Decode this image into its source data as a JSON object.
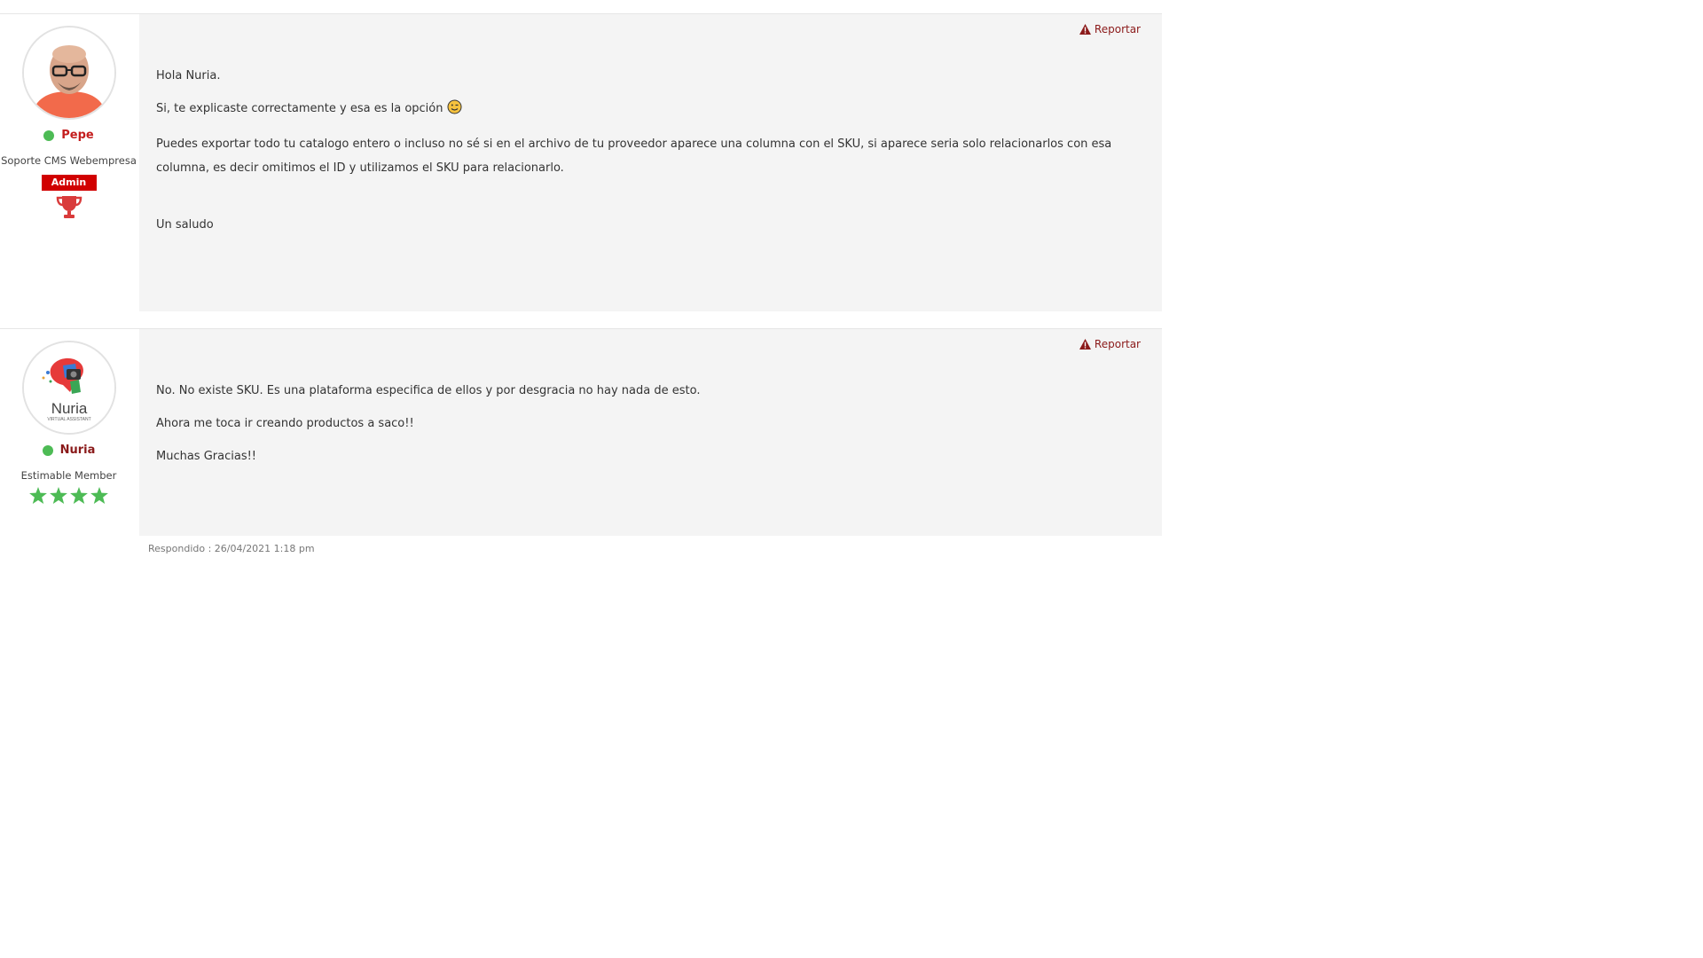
{
  "posts": [
    {
      "author": {
        "name": "Pepe",
        "online": true,
        "title": "Soporte CMS Webempresa",
        "badge": "Admin",
        "award_icon": "trophy-icon"
      },
      "report_label": "Reportar",
      "paragraphs": [
        "Hola Nuria.",
        "Si, te explicaste correctamente y esa es la opción",
        "Puedes exportar todo tu catalogo entero o incluso no sé si en el archivo de tu proveedor aparece una columna con el SKU, si aparece seria solo relacionarlos con esa columna, es decir omitimos el ID y utilizamos el SKU para relacionarlo.",
        "Un saludo"
      ],
      "emoji": "winking-face-icon"
    },
    {
      "author": {
        "name": "Nuria",
        "online": true,
        "title": "Estimable Member",
        "stars": 4,
        "avatar_text": "Nuria",
        "avatar_subtext": "VIRTUAL ASSISTANT"
      },
      "report_label": "Reportar",
      "paragraphs": [
        "No. No existe SKU. Es una plataforma especifica de ellos y por desgracia no hay nada de esto.",
        "Ahora me toca ir creando productos a saco!!",
        "Muchas Gracias!!"
      ],
      "timestamp": "Respondido : 26/04/2021 1:18 pm"
    }
  ],
  "colors": {
    "online": "#4dbb55",
    "admin_badge": "#d10000",
    "report": "#8b1a1a",
    "star": "#4dbb55",
    "trophy": "#d93b3b"
  }
}
